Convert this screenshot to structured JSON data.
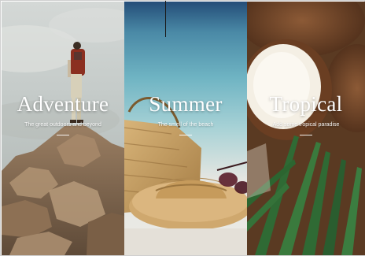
{
  "panels": [
    {
      "title": "Adventure",
      "subtitle": "The great outdoors and beyond",
      "scene": "hiker-on-rocks"
    },
    {
      "title": "Summer",
      "subtitle": "The smell of the beach",
      "scene": "straw-hat-and-bag-on-sand"
    },
    {
      "title": "Tropical",
      "subtitle": "Add some tropical paradise",
      "scene": "coconuts-and-palm-leaves"
    }
  ],
  "colors": {
    "caption_text": "#ffffff",
    "adventure_sky": "#c9cfcf",
    "summer_sea": "#5fa6b8",
    "tropical_coconut": "#7b4a2c",
    "palm_green": "#2f6a34"
  }
}
